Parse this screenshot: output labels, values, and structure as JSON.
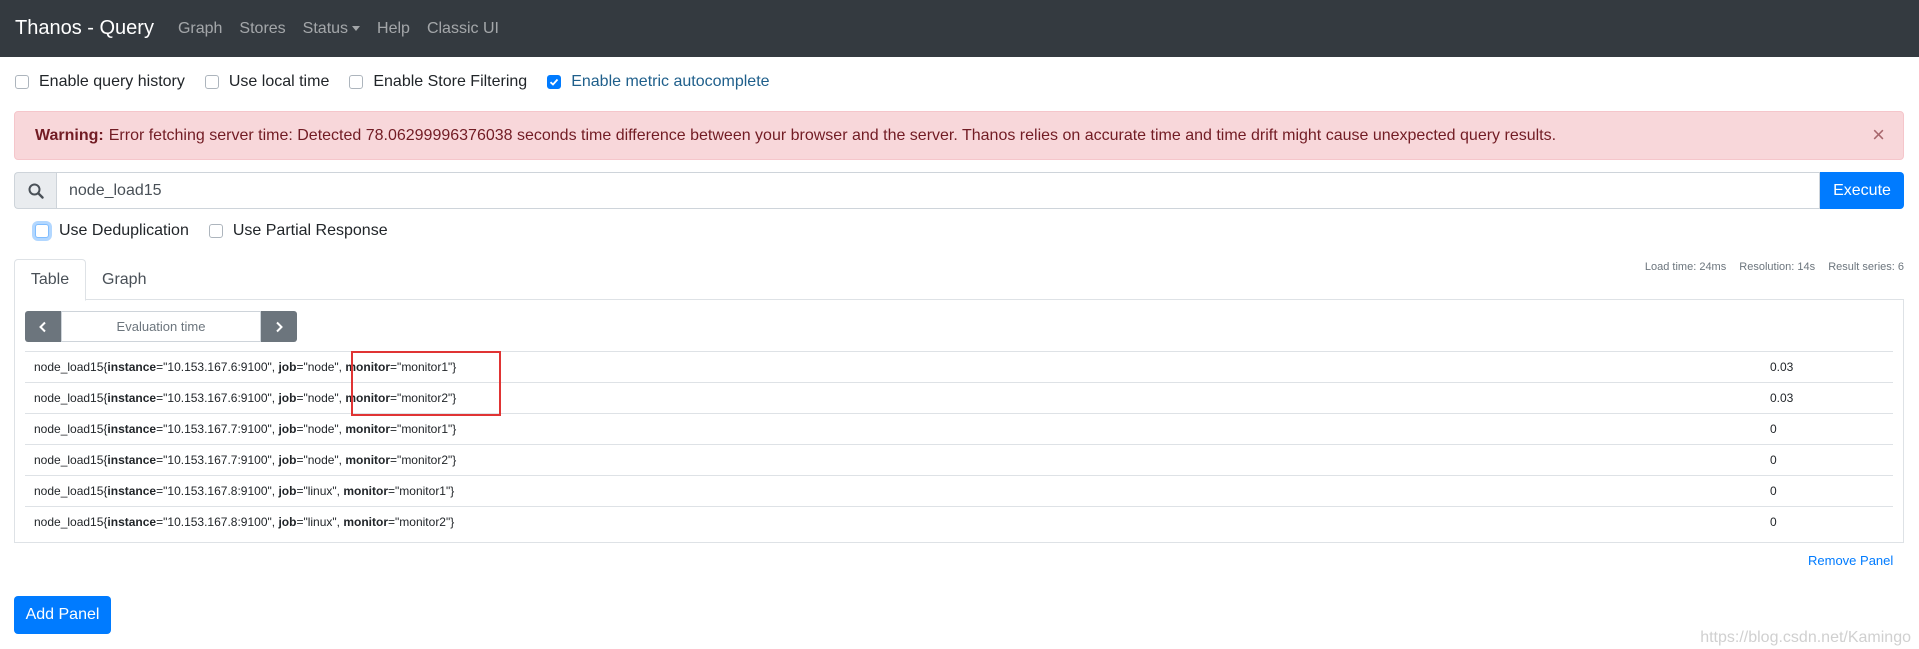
{
  "navbar": {
    "brand": "Thanos - Query",
    "links": [
      "Graph",
      "Stores",
      "Status",
      "Help",
      "Classic UI"
    ]
  },
  "options": {
    "query_history": "Enable query history",
    "local_time": "Use local time",
    "store_filtering": "Enable Store Filtering",
    "metric_autocomplete": "Enable metric autocomplete"
  },
  "alert": {
    "strong": "Warning:",
    "message": "Error fetching server time: Detected 78.06299996376038 seconds time difference between your browser and the server. Thanos relies on accurate time and time drift might cause unexpected query results.",
    "close": "×"
  },
  "query": {
    "expression": "node_load15",
    "execute": "Execute",
    "deduplication": "Use Deduplication",
    "partial_response": "Use Partial Response"
  },
  "meta": {
    "load_time": "Load time: 24ms",
    "resolution": "Resolution: 14s",
    "result_series": "Result series: 6"
  },
  "tabs": [
    "Table",
    "Graph"
  ],
  "eval": {
    "placeholder": "Evaluation time"
  },
  "results": [
    {
      "name": "node_load15",
      "instance": "10.153.167.6:9100",
      "job": "node",
      "monitor": "monitor1",
      "value": "0.03"
    },
    {
      "name": "node_load15",
      "instance": "10.153.167.6:9100",
      "job": "node",
      "monitor": "monitor2",
      "value": "0.03"
    },
    {
      "name": "node_load15",
      "instance": "10.153.167.7:9100",
      "job": "node",
      "monitor": "monitor1",
      "value": "0"
    },
    {
      "name": "node_load15",
      "instance": "10.153.167.7:9100",
      "job": "node",
      "monitor": "monitor2",
      "value": "0"
    },
    {
      "name": "node_load15",
      "instance": "10.153.167.8:9100",
      "job": "linux",
      "monitor": "monitor1",
      "value": "0"
    },
    {
      "name": "node_load15",
      "instance": "10.153.167.8:9100",
      "job": "linux",
      "monitor": "monitor2",
      "value": "0"
    }
  ],
  "remove_panel": "Remove Panel",
  "add_panel": "Add Panel",
  "watermark": "https://blog.csdn.net/Kamingo",
  "colors": {
    "navbar": "#343a40",
    "primary": "#007bff",
    "alert_bg": "#f8d7da",
    "highlight": "#e03434"
  }
}
